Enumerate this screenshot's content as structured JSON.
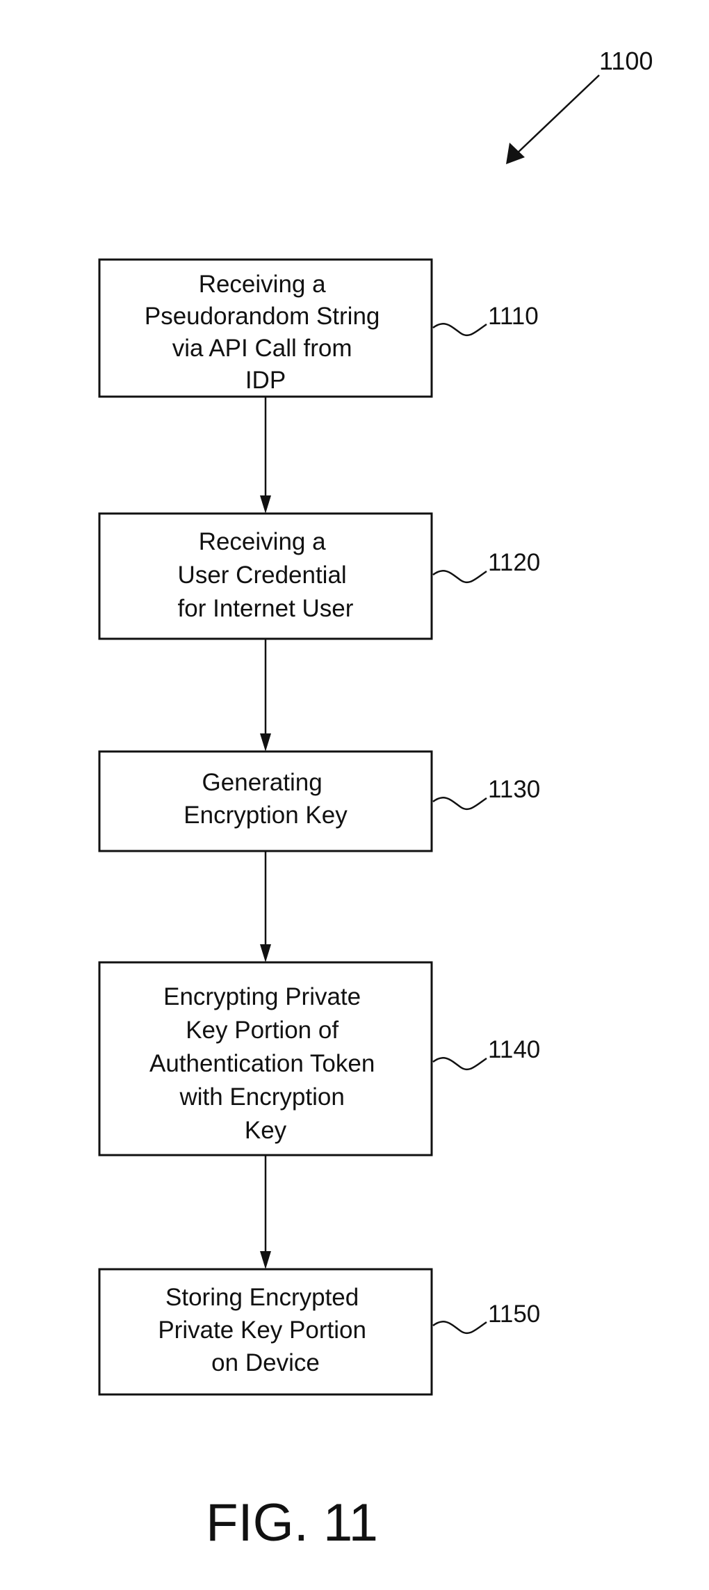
{
  "figure": {
    "reference": "1100",
    "caption": "FIG. 11"
  },
  "steps": [
    {
      "id": "1110",
      "lines": [
        "Receiving a",
        "Pseudorandom String",
        "via API Call from",
        "IDP"
      ]
    },
    {
      "id": "1120",
      "lines": [
        "Receiving a",
        "User Credential",
        "for Internet User"
      ]
    },
    {
      "id": "1130",
      "lines": [
        "Generating",
        "Encryption Key"
      ]
    },
    {
      "id": "1140",
      "lines": [
        "Encrypting Private",
        "Key Portion of",
        "Authentication Token",
        "with Encryption",
        "Key"
      ]
    },
    {
      "id": "1150",
      "lines": [
        "Storing Encrypted",
        "Private Key Portion",
        "on Device"
      ]
    }
  ]
}
